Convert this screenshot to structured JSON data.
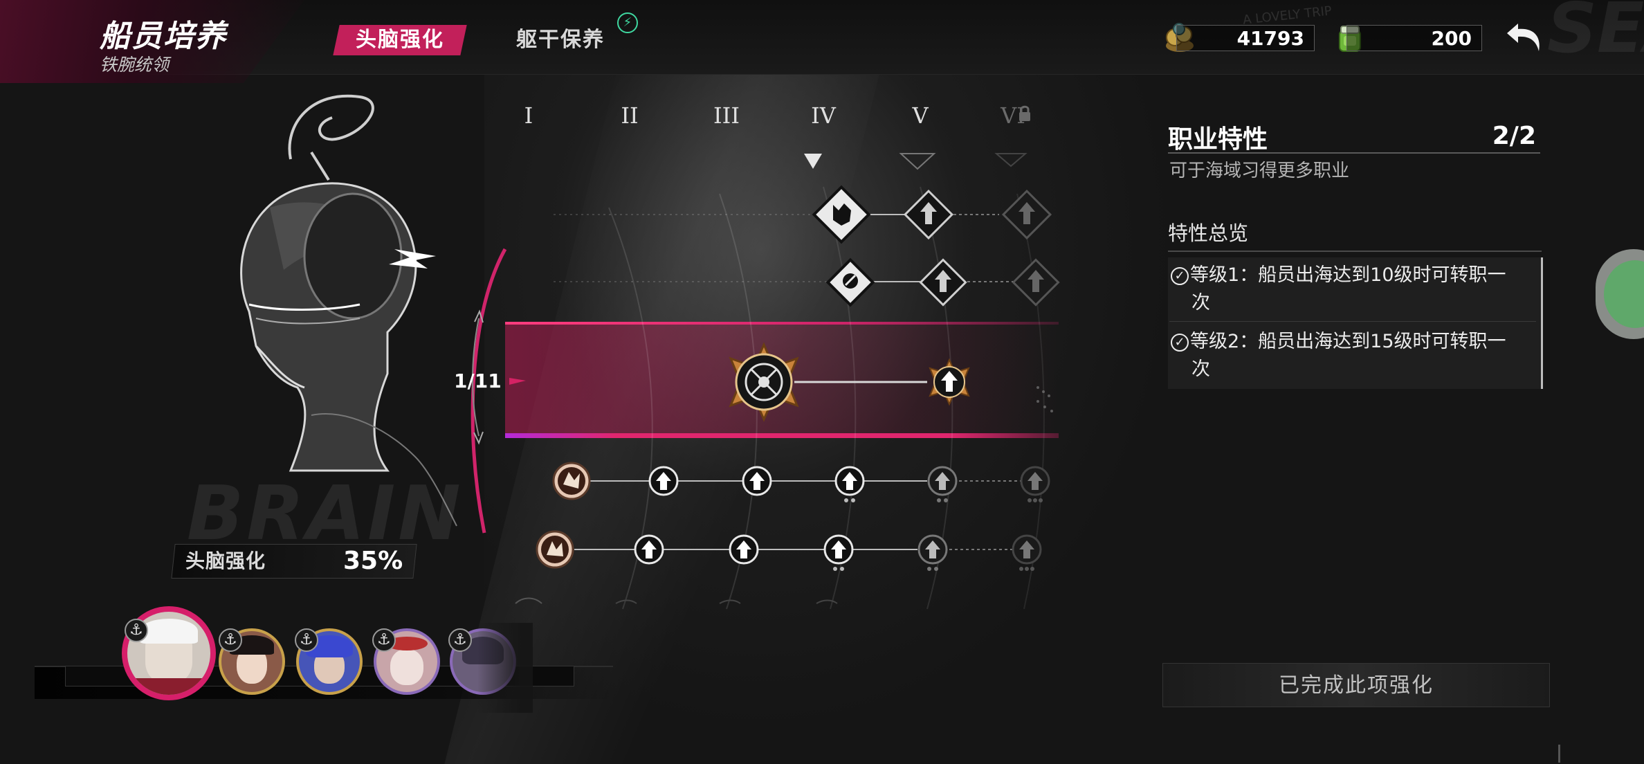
{
  "header": {
    "title": "船员培养",
    "subtitle": "铁腕统领",
    "tabs": [
      {
        "label": "头脑强化",
        "active": true
      },
      {
        "label": "躯干保养",
        "active": false,
        "badge_icon": "lightning-icon"
      }
    ],
    "currencies": [
      {
        "icon": "coin-pile-icon",
        "value": "41793"
      },
      {
        "icon": "green-jar-icon",
        "value": "200"
      }
    ],
    "back_icon": "back-arrow-icon",
    "decoration_text": "A LOVELY TRIP",
    "decoration_big": "SEA"
  },
  "head": {
    "watermark": "BRAIN",
    "progress_label": "头脑强化",
    "progress_value": "35%",
    "level_ratio": "1/11"
  },
  "tree": {
    "columns": [
      "I",
      "II",
      "III",
      "IV",
      "V",
      "VI"
    ],
    "locked_column": "VI",
    "selected_row_color": "#e0266e"
  },
  "panel": {
    "title": "职业特性",
    "count": "2/2",
    "description": "可于海域习得更多职业",
    "overview_title": "特性总览",
    "traits": [
      {
        "line1": "等级1：船员出海达到10级时可转职一",
        "line2": "次"
      },
      {
        "line1": "等级2：船员出海达到15级时可转职一",
        "line2": "次"
      }
    ],
    "complete_label": "已完成此项强化"
  },
  "crew": {
    "members": [
      {
        "name": "crew-avatar-1",
        "selected": true,
        "bg": "#cfc7bf"
      },
      {
        "name": "crew-avatar-2",
        "selected": false,
        "bg": "#8a5a48"
      },
      {
        "name": "crew-avatar-3",
        "selected": false,
        "bg": "#4655b8"
      },
      {
        "name": "crew-avatar-4",
        "selected": false,
        "bg": "#c8a5a9"
      },
      {
        "name": "crew-avatar-5",
        "selected": false,
        "bg": "#6a5e7a"
      }
    ]
  },
  "colors": {
    "accent": "#c2205a",
    "band_pink": "#e0266e",
    "node_gold": "#c8833a",
    "panel_text": "#ececec"
  }
}
